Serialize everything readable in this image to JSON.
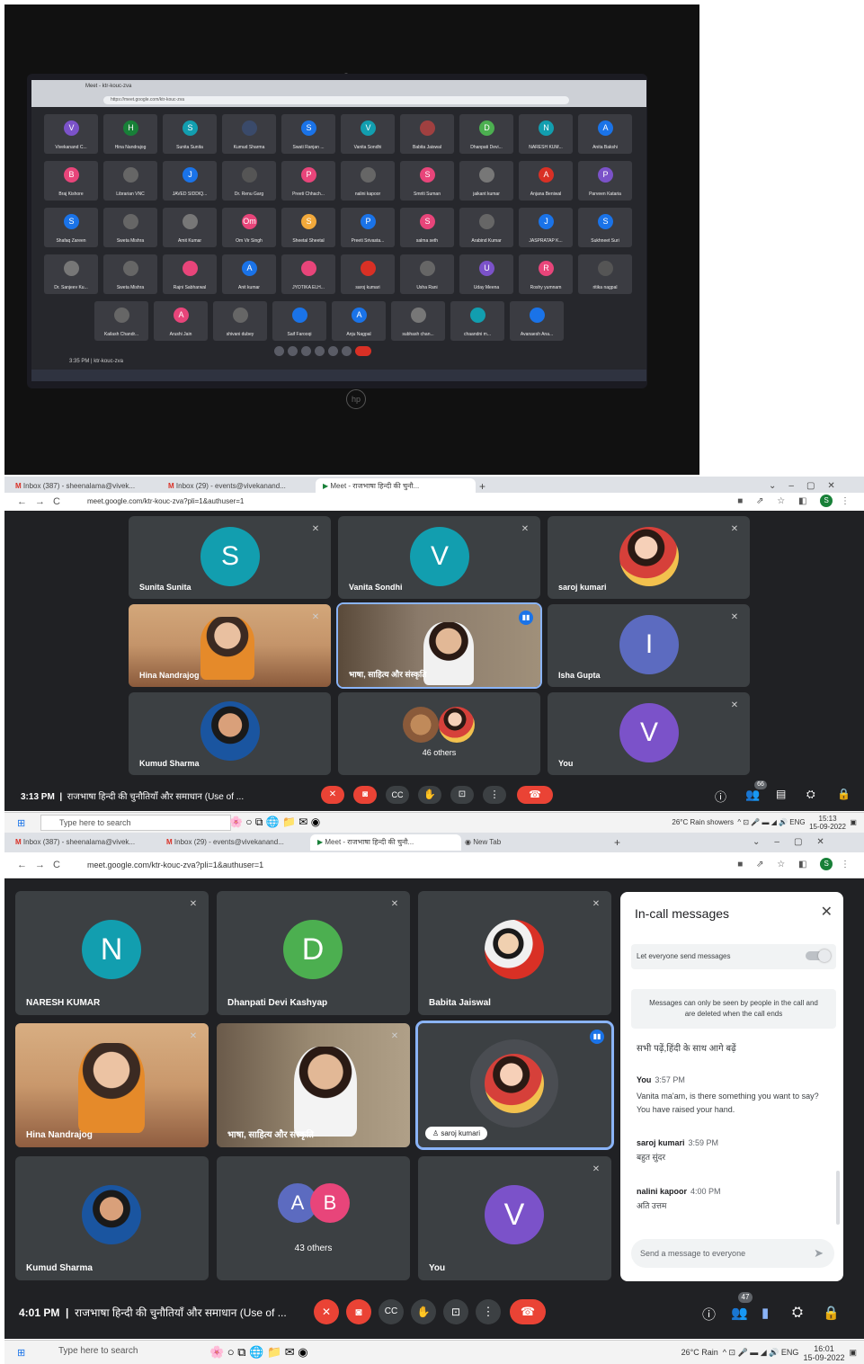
{
  "photo": {
    "tab_title": "Meet - ktr-kouc-zva",
    "url": "https://meet.google.com/ktr-kouc-zva",
    "time": "3:35 PM  |  ktr-kouc-zva",
    "brand": "hp",
    "participants": [
      {
        "name": "Vivekanand C...",
        "initial": "V",
        "color": "#7b52c9"
      },
      {
        "name": "Hina Nandrajog",
        "initial": "H",
        "color": "#188038"
      },
      {
        "name": "Sunita Sunita",
        "initial": "S",
        "color": "#129eaf"
      },
      {
        "name": "Kumud Sharma",
        "initial": "",
        "color": "#3a4a6a"
      },
      {
        "name": "Swati Ranjan ...",
        "initial": "S",
        "color": "#1a73e8"
      },
      {
        "name": "Vanita Sondhi",
        "initial": "V",
        "color": "#129eaf"
      },
      {
        "name": "Babita Jaiswal",
        "initial": "",
        "color": "#a04040"
      },
      {
        "name": "Dhanpati Devi...",
        "initial": "D",
        "color": "#4caf50"
      },
      {
        "name": "NARESH KUM...",
        "initial": "N",
        "color": "#129eaf"
      },
      {
        "name": "Anita Bakshi",
        "initial": "A",
        "color": "#1a73e8"
      },
      {
        "name": "Braj Kishore",
        "initial": "B",
        "color": "#e8457a"
      },
      {
        "name": "Librarian VNC",
        "initial": "",
        "color": "#666"
      },
      {
        "name": "JAVED SIDDIQ...",
        "initial": "J",
        "color": "#1a73e8"
      },
      {
        "name": "Dr. Renu Garg",
        "initial": "",
        "color": "#555"
      },
      {
        "name": "Preeti Chhach...",
        "initial": "P",
        "color": "#e8457a"
      },
      {
        "name": "nalini kapoor",
        "initial": "",
        "color": "#666"
      },
      {
        "name": "Smriti Suman",
        "initial": "S",
        "color": "#e8457a"
      },
      {
        "name": "jaikant kumar",
        "initial": "",
        "color": "#777"
      },
      {
        "name": "Anjana Beniwal",
        "initial": "A",
        "color": "#d93025"
      },
      {
        "name": "Parveen Kataria",
        "initial": "P",
        "color": "#7b52c9"
      },
      {
        "name": "Shafaq Zareen",
        "initial": "S",
        "color": "#1a73e8"
      },
      {
        "name": "Sweta Mishra",
        "initial": "",
        "color": "#666"
      },
      {
        "name": "Amit Kumar",
        "initial": "",
        "color": "#777"
      },
      {
        "name": "Om Vir Singh",
        "initial": "Om",
        "color": "#e8457a"
      },
      {
        "name": "Sheetal Sheetal",
        "initial": "S",
        "color": "#f2a93b"
      },
      {
        "name": "Preeti Srivasta...",
        "initial": "P",
        "color": "#1a73e8"
      },
      {
        "name": "salma seth",
        "initial": "S",
        "color": "#e8457a"
      },
      {
        "name": "Arabind Kumar",
        "initial": "",
        "color": "#666"
      },
      {
        "name": "JASPRATAP K...",
        "initial": "J",
        "color": "#1a73e8"
      },
      {
        "name": "Sukhneet Suri",
        "initial": "S",
        "color": "#1a73e8"
      },
      {
        "name": "Dr. Sanjeev Ku...",
        "initial": "",
        "color": "#777"
      },
      {
        "name": "Sweta Mishra",
        "initial": "",
        "color": "#666"
      },
      {
        "name": "Rajni Sabharwal",
        "initial": "",
        "color": "#e8457a"
      },
      {
        "name": "Anit kumar",
        "initial": "A",
        "color": "#1a73e8"
      },
      {
        "name": "JYOTIKA ELH...",
        "initial": "",
        "color": "#e8457a"
      },
      {
        "name": "saroj kumari",
        "initial": "",
        "color": "#d93025"
      },
      {
        "name": "Usha Rani",
        "initial": "",
        "color": "#666"
      },
      {
        "name": "Uday Meena",
        "initial": "U",
        "color": "#7b52c9"
      },
      {
        "name": "Roshy yumnam",
        "initial": "R",
        "color": "#e8457a"
      },
      {
        "name": "ritika nagpal",
        "initial": "",
        "color": "#555"
      },
      {
        "name": "Kailash Chandr...",
        "initial": "",
        "color": "#666"
      },
      {
        "name": "Arushi Jain",
        "initial": "A",
        "color": "#e8457a"
      },
      {
        "name": "shivani dubey",
        "initial": "",
        "color": "#666"
      },
      {
        "name": "Saif Farooqi",
        "initial": "",
        "color": "#1a73e8"
      },
      {
        "name": "Anju Nagpal",
        "initial": "A",
        "color": "#1a73e8"
      },
      {
        "name": "subhash chan...",
        "initial": "",
        "color": "#777"
      },
      {
        "name": "chaandni m...",
        "initial": "",
        "color": "#129eaf"
      },
      {
        "name": "Avanaesh Ana...",
        "initial": "",
        "color": "#1a73e8"
      }
    ]
  },
  "shot1": {
    "tabs": [
      {
        "label": "Inbox (387) - sheenalama@vivek..."
      },
      {
        "label": "Inbox (29) - events@vivekanand..."
      },
      {
        "label": "Meet - राजभाषा हिन्दी की चुनौ..."
      }
    ],
    "url": "meet.google.com/ktr-kouc-zva?pli=1&authuser=1",
    "tiles": [
      {
        "name": "Sunita Sunita",
        "initial": "S",
        "color": "#129eaf"
      },
      {
        "name": "Vanita Sondhi",
        "initial": "V",
        "color": "#129eaf"
      },
      {
        "name": "saroj kumari",
        "initial": "",
        "color": ""
      },
      {
        "name": "Hina Nandrajog",
        "initial": "",
        "color": ""
      },
      {
        "name": "भाषा, साहित्य और संस्कृति",
        "initial": "",
        "color": ""
      },
      {
        "name": "Isha Gupta",
        "initial": "I",
        "color": "#5c6bc0"
      },
      {
        "name": "Kumud Sharma",
        "initial": "",
        "color": ""
      },
      {
        "name": "46 others",
        "initial": "",
        "color": ""
      },
      {
        "name": "You",
        "initial": "V",
        "color": "#7b52c9"
      }
    ],
    "time": "3:13 PM",
    "meeting_title": "राजभाषा हिन्दी की चुनौतियाँ और समाधान (Use of ...",
    "participants_badge": "66",
    "taskbar": {
      "search": "Type here to search",
      "weather": "26°C  Rain showers",
      "lang": "ENG",
      "clock_time": "15:13",
      "clock_date": "15-09-2022"
    }
  },
  "shot2": {
    "tabs": [
      {
        "label": "Inbox (387) - sheenalama@vivek..."
      },
      {
        "label": "Inbox (29) - events@vivekanand..."
      },
      {
        "label": "Meet - राजभाषा हिन्दी की चुनौ..."
      },
      {
        "label": "New Tab"
      }
    ],
    "url": "meet.google.com/ktr-kouc-zva?pli=1&authuser=1",
    "tiles": [
      {
        "name": "NARESH KUMAR",
        "initial": "N",
        "color": "#129eaf"
      },
      {
        "name": "Dhanpati Devi Kashyap",
        "initial": "D",
        "color": "#4caf50"
      },
      {
        "name": "Babita Jaiswal",
        "initial": "",
        "color": ""
      },
      {
        "name": "Hina Nandrajog",
        "initial": "",
        "color": ""
      },
      {
        "name": "भाषा, साहित्य और संस्कृति",
        "initial": "",
        "color": ""
      },
      {
        "name": "saroj kumari",
        "initial": "",
        "color": ""
      },
      {
        "name": "Kumud Sharma",
        "initial": "",
        "color": ""
      },
      {
        "name": "43 others",
        "initial": "",
        "color": ""
      },
      {
        "name": "You",
        "initial": "V",
        "color": "#7b52c9"
      }
    ],
    "others_initials": [
      "A",
      "B"
    ],
    "time": "4:01 PM",
    "meeting_title": "राजभाषा हिन्दी की चुनौतियाँ और समाधान (Use of ...",
    "participants_badge": "47",
    "chat": {
      "title": "In-call messages",
      "toggle_label": "Let everyone send messages",
      "notice": "Messages can only be seen by people in the call and are deleted when the call ends",
      "messages": [
        {
          "sender": "",
          "time": "",
          "text": "सभी पढ़ें,हिंदी के साथ आगे बढ़ें"
        },
        {
          "sender": "You",
          "time": "3:57 PM",
          "text": "Vanita ma'am, is there something you want to say? You have raised your hand."
        },
        {
          "sender": "saroj kumari",
          "time": "3:59 PM",
          "text": "बहुत सुंदर"
        },
        {
          "sender": "nalini kapoor",
          "time": "4:00 PM",
          "text": "अति उत्तम"
        }
      ],
      "input_placeholder": "Send a message to everyone"
    },
    "taskbar": {
      "search": "Type here to search",
      "weather": "26°C  Rain",
      "lang": "ENG",
      "clock_time": "16:01",
      "clock_date": "15-09-2022"
    }
  }
}
